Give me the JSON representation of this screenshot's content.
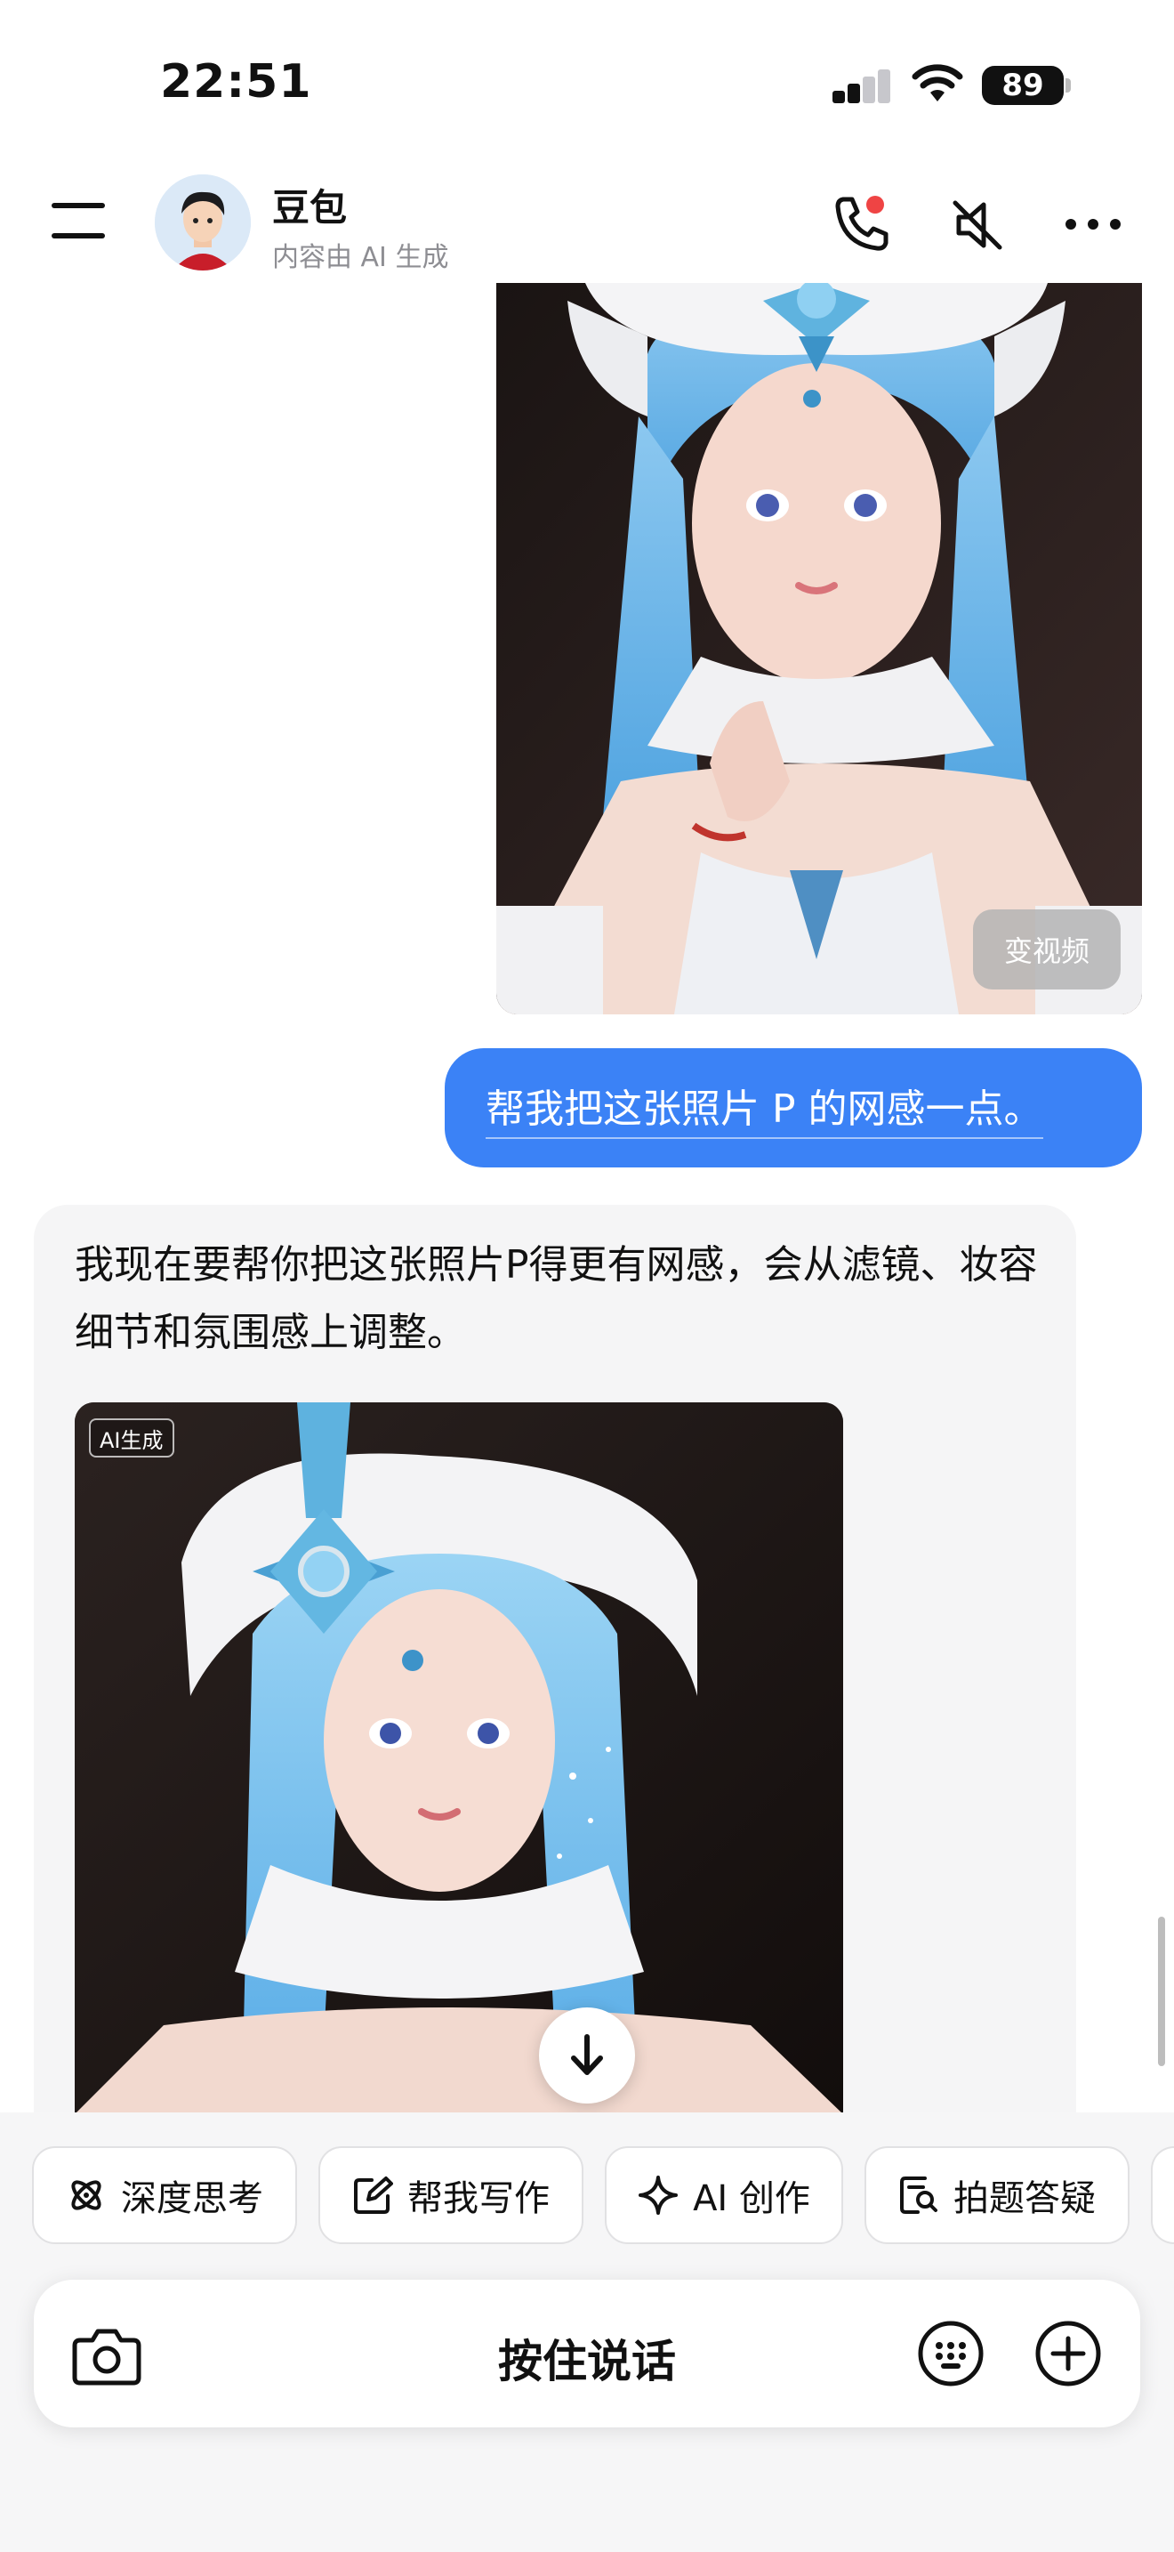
{
  "status_bar": {
    "time": "22:51",
    "battery": "89"
  },
  "header": {
    "title": "豆包",
    "subtitle": "内容由 AI 生成",
    "icons": [
      "menu-icon",
      "phone-icon",
      "mute-icon",
      "more-icon"
    ]
  },
  "conversation": {
    "user_image": {
      "action_label": "变视频"
    },
    "user_message": "帮我把这张照片 P 的网感一点。",
    "ai_message": "我现在要帮你把这张照片P得更有网感，会从滤镜、妆容细节和氛围感上调整。",
    "ai_image": {
      "badge": "AI生成"
    }
  },
  "quick_actions": [
    {
      "label": "深度思考",
      "icon": "atom-icon"
    },
    {
      "label": "帮我写作",
      "icon": "edit-icon"
    },
    {
      "label": "AI 创作",
      "icon": "sparkle-icon"
    },
    {
      "label": "拍题答疑",
      "icon": "search-doc-icon"
    }
  ],
  "input_bar": {
    "label": "按住说话"
  },
  "colors": {
    "accent": "#3b82f6",
    "ai_bubble": "#f5f5f6"
  }
}
